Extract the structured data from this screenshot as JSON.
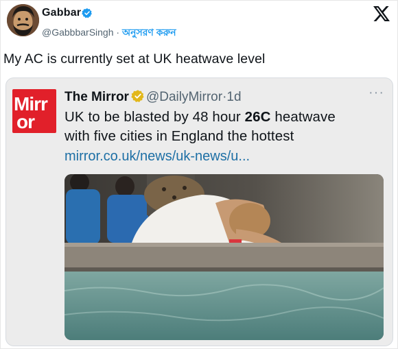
{
  "tweet": {
    "author_name": "Gabbar",
    "handle": "@GabbbarSingh",
    "separator": " · ",
    "follow_label": "অনুসরণ করুন",
    "text": "My AC is currently set at UK heatwave level"
  },
  "quoted": {
    "logo_line1": "Mirr",
    "logo_line2": "or",
    "author_name": "The Mirror",
    "handle": "@DailyMirror",
    "dot": "·",
    "time": "1d",
    "text_part1": "UK to be blasted by 48 hour ",
    "text_bold": "26C",
    "text_part2": " heatwave",
    "text_line2": "with five cities in England the hottest",
    "link": "mirror.co.uk/news/uk-news/u..."
  },
  "icons": {
    "verified": "verified-badge-icon",
    "gold_verified": "gold-verified-badge-icon",
    "x_logo": "x-logo-icon",
    "more": "more-options-icon"
  },
  "colors": {
    "link": "#1d9bf0",
    "verified": "#1d9bf0",
    "gold": "#e2b719",
    "mirror_red": "#e1202a"
  }
}
